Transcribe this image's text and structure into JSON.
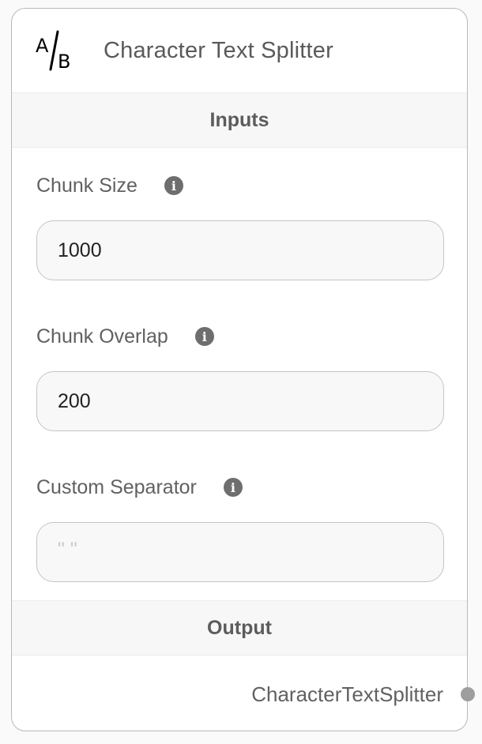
{
  "node": {
    "title": "Character Text Splitter",
    "icon": "ab-splitter-icon"
  },
  "inputs_section": {
    "label": "Inputs"
  },
  "fields": [
    {
      "label": "Chunk Size",
      "value": "1000",
      "placeholder": ""
    },
    {
      "label": "Chunk Overlap",
      "value": "200",
      "placeholder": ""
    },
    {
      "label": "Custom Separator",
      "value": "",
      "placeholder": "\" \""
    }
  ],
  "info_icon_glyph": "i",
  "output_section": {
    "label": "Output",
    "output_name": "CharacterTextSplitter"
  },
  "colors": {
    "title": "#5a5a5a",
    "border": "#b9b9b9",
    "handle": "#9e9e9e"
  }
}
